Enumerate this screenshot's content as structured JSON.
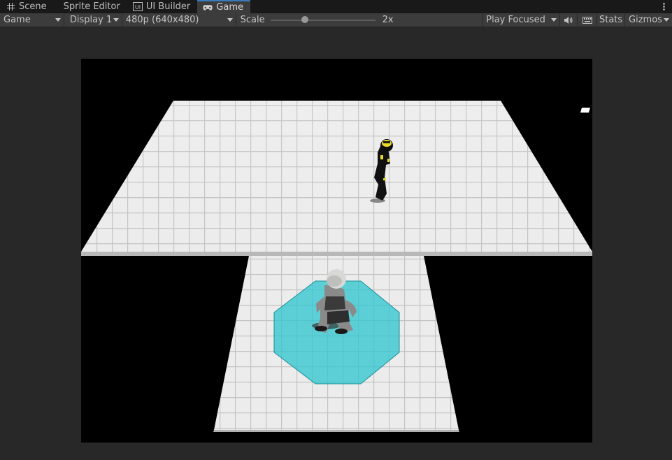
{
  "tabs": [
    {
      "label": "Scene",
      "icon": "grid-icon"
    },
    {
      "label": "Sprite Editor",
      "icon": ""
    },
    {
      "label": "UI Builder",
      "icon": "ui-builder-icon"
    },
    {
      "label": "Game",
      "icon": "gamepad-icon",
      "active": true
    }
  ],
  "toolbar": {
    "view_mode": "Game",
    "display": "Display 1",
    "resolution": "480p (640x480)",
    "scale_label": "Scale",
    "scale_value": "2x",
    "scale_fraction": 0.33,
    "play_mode": "Play Focused",
    "stats_label": "Stats",
    "gizmos_label": "Gizmos"
  },
  "colors": {
    "accent": "#3a79bb",
    "tab_bg": "#191919",
    "toolbar_bg": "#3c3c3c",
    "panel_bg": "#282828",
    "floor": "#ececec",
    "selection_circle": "#33c7cf",
    "enemy_accent": "#f4e21a"
  }
}
